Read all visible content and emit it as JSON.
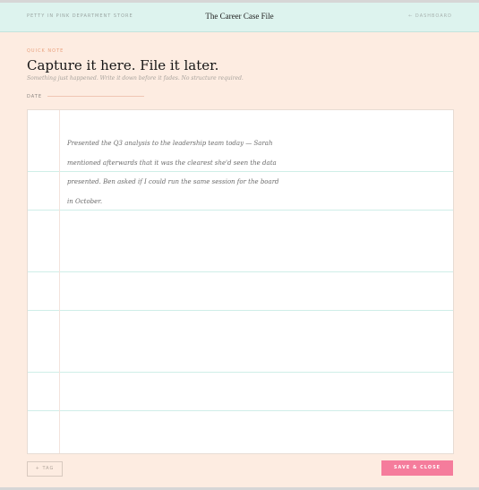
{
  "header": {
    "brand": "PETTY IN PINK DEPARTMENT STORE",
    "title": "The Career Case File",
    "dashboard_link": "← DASHBOARD"
  },
  "quick_note": {
    "eyebrow": "QUICK NOTE",
    "heading": "Capture it here. File it later.",
    "subtitle": "Something just happened. Write it down before it fades. No structure required."
  },
  "form": {
    "date_label": "DATE",
    "date_value": "",
    "note_text": "Presented the Q3 analysis to the leadership team today — Sarah mentioned afterwards that it was the clearest she'd seen the data presented. Ben asked if I could run the same session for the board in October."
  },
  "footer": {
    "tag_button": "+ TAG",
    "save_button": "SAVE & CLOSE"
  },
  "colors": {
    "topbar": "#ddf3ee",
    "page_background": "#fdece1",
    "accent": "#f57c9c",
    "eyebrow": "#e9a07d",
    "rule_lines": "#cfeee8"
  }
}
